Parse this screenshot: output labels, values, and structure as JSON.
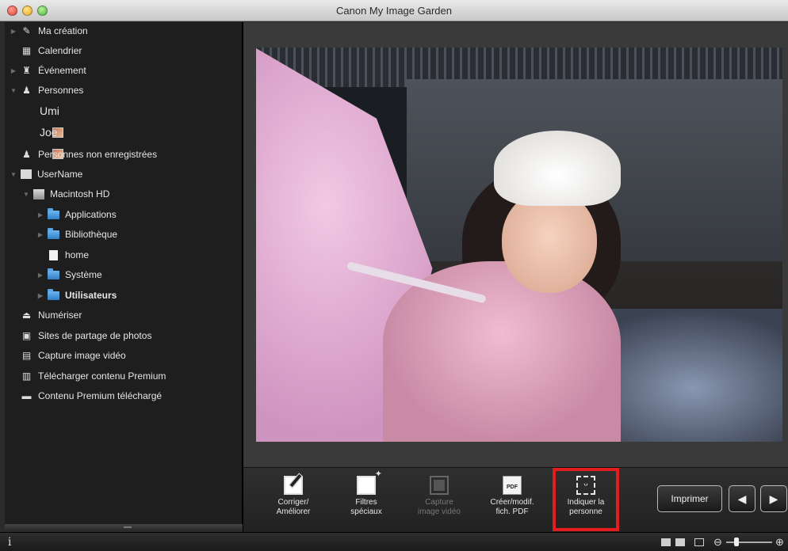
{
  "window": {
    "title": "Canon My Image Garden"
  },
  "sidebar": {
    "items": [
      {
        "label": "Ma création"
      },
      {
        "label": "Calendrier"
      },
      {
        "label": "Événement"
      },
      {
        "label": "Personnes"
      },
      {
        "label": "Umi"
      },
      {
        "label": "Joe"
      },
      {
        "label": "Personnes non enregistrées"
      },
      {
        "label": "UserName"
      },
      {
        "label": "Macintosh HD"
      },
      {
        "label": "Applications"
      },
      {
        "label": "Bibliothèque"
      },
      {
        "label": "home"
      },
      {
        "label": "Système"
      },
      {
        "label": "Utilisateurs"
      },
      {
        "label": "Numériser"
      },
      {
        "label": "Sites de partage de photos"
      },
      {
        "label": "Capture image vidéo"
      },
      {
        "label": "Télécharger contenu Premium"
      },
      {
        "label": "Contenu Premium téléchargé"
      }
    ]
  },
  "toolbar": {
    "correct": "Corriger/\nAméliorer",
    "filters": "Filtres\nspéciaux",
    "capture": "Capture\nimage vidéo",
    "pdf": "Créer/modif.\nfich. PDF",
    "identify": "Indiquer la\npersonne",
    "print": "Imprimer",
    "prev": "◀",
    "next": "▶"
  },
  "statusbar": {
    "info": "i",
    "zoom_out": "⊖",
    "zoom_in": "⊕"
  }
}
